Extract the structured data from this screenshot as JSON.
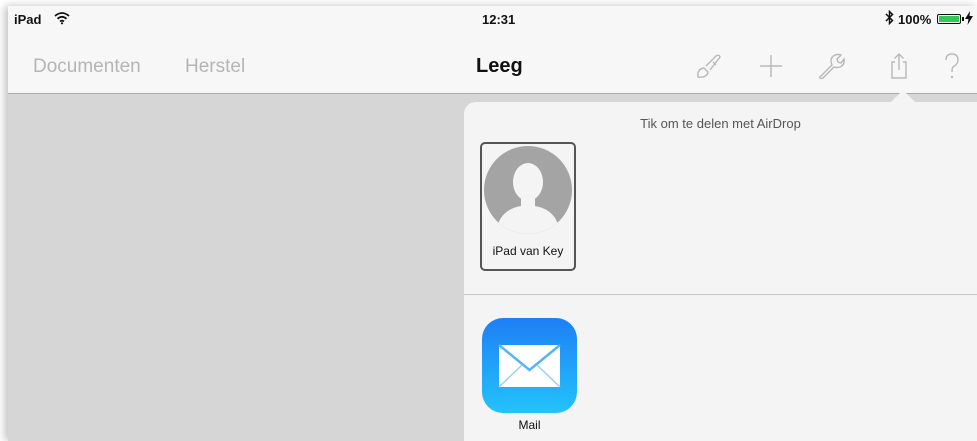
{
  "statusbar": {
    "device": "iPad",
    "time": "12:31",
    "battery": "100%",
    "icons": [
      "wifi-icon",
      "bluetooth-icon",
      "battery-icon",
      "charging-icon"
    ]
  },
  "navbar": {
    "documents_label": "Documenten",
    "undo_label": "Herstel",
    "title": "Leeg",
    "icons": [
      "brush-icon",
      "plus-icon",
      "wrench-icon",
      "share-icon",
      "help-icon"
    ]
  },
  "share": {
    "airdrop_hint": "Tik om te delen met AirDrop",
    "airdrop_device": "iPad van Key",
    "apps": [
      {
        "label": "Mail",
        "icon": "mail-icon"
      }
    ]
  },
  "colors": {
    "mail_gradient_top": "#1e7ff5",
    "mail_gradient_bottom": "#23c3fb",
    "battery_fill": "#34c759",
    "nav_inactive": "#b5b5b5"
  }
}
